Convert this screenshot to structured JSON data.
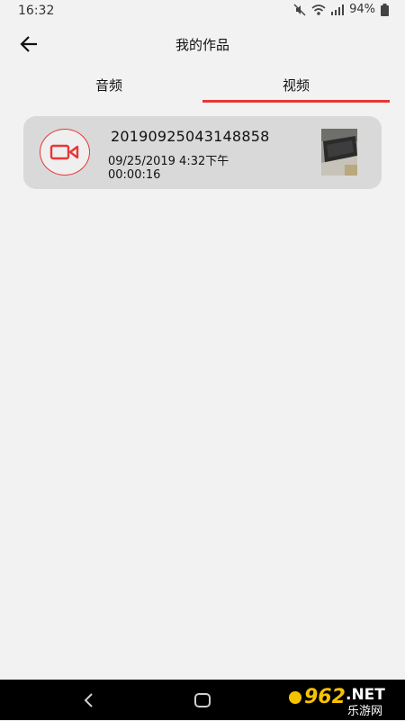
{
  "status": {
    "time": "16:32",
    "battery": "94%"
  },
  "header": {
    "title": "我的作品",
    "back_icon": "arrow-left-icon"
  },
  "tabs": [
    {
      "label": "音频",
      "selected": false
    },
    {
      "label": "视频",
      "selected": true
    }
  ],
  "colors": {
    "accent": "#e53935",
    "card": "#d9d9d9",
    "background": "#f2f2f2"
  },
  "items": [
    {
      "name": "20190925043148858",
      "date": "09/25/2019 4:32下午",
      "duration": "00:00:16",
      "icon": "video-camera-icon"
    }
  ],
  "watermark": {
    "brand": "962",
    "suffix": ".NET",
    "sub": "乐游网"
  }
}
